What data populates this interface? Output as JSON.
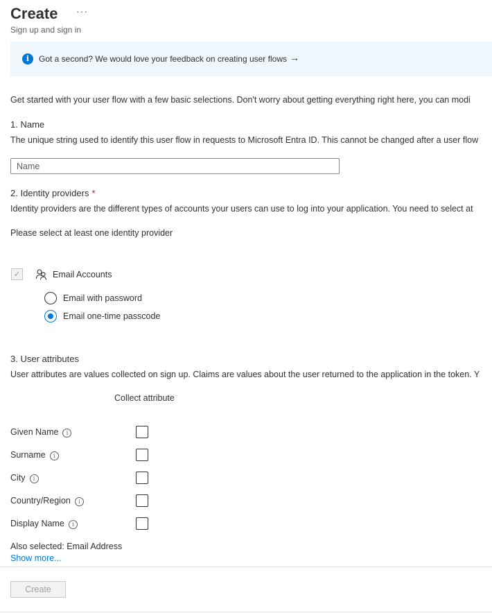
{
  "header": {
    "title": "Create",
    "more_label": "···",
    "subtitle": "Sign up and sign in"
  },
  "banner": {
    "icon": "info-icon",
    "text": "Got a second? We would love your feedback on creating user flows",
    "arrow": "→"
  },
  "intro": "Get started with your user flow with a few basic selections. Don't worry about getting everything right here, you can modi",
  "section_name": {
    "heading": "1. Name",
    "description": "The unique string used to identify this user flow in requests to Microsoft Entra ID. This cannot be changed after a user flow",
    "input_value": "",
    "input_placeholder": "Name"
  },
  "section_identity": {
    "heading": "2. Identity providers",
    "required_marker": "*",
    "description": "Identity providers are the different types of accounts your users can use to log into your application. You need to select at",
    "prompt": "Please select at least one identity provider",
    "provider": {
      "label": "Email Accounts",
      "checked": true,
      "disabled": true,
      "icon": "people-icon"
    },
    "options": [
      {
        "label": "Email with password",
        "selected": false
      },
      {
        "label": "Email one-time passcode",
        "selected": true
      }
    ]
  },
  "section_attributes": {
    "heading": "3. User attributes",
    "description": "User attributes are values collected on sign up. Claims are values about the user returned to the application in the token. Y",
    "column_header": "Collect attribute",
    "attributes": [
      {
        "label": "Given Name",
        "checked": false
      },
      {
        "label": "Surname",
        "checked": false
      },
      {
        "label": "City",
        "checked": false
      },
      {
        "label": "Country/Region",
        "checked": false
      },
      {
        "label": "Display Name",
        "checked": false
      }
    ],
    "also_selected": "Also selected: Email Address",
    "show_more": "Show more..."
  },
  "footer": {
    "create_label": "Create"
  },
  "colors": {
    "accent": "#0078d4",
    "banner_bg": "#eff6fc",
    "required": "#a4262c"
  }
}
